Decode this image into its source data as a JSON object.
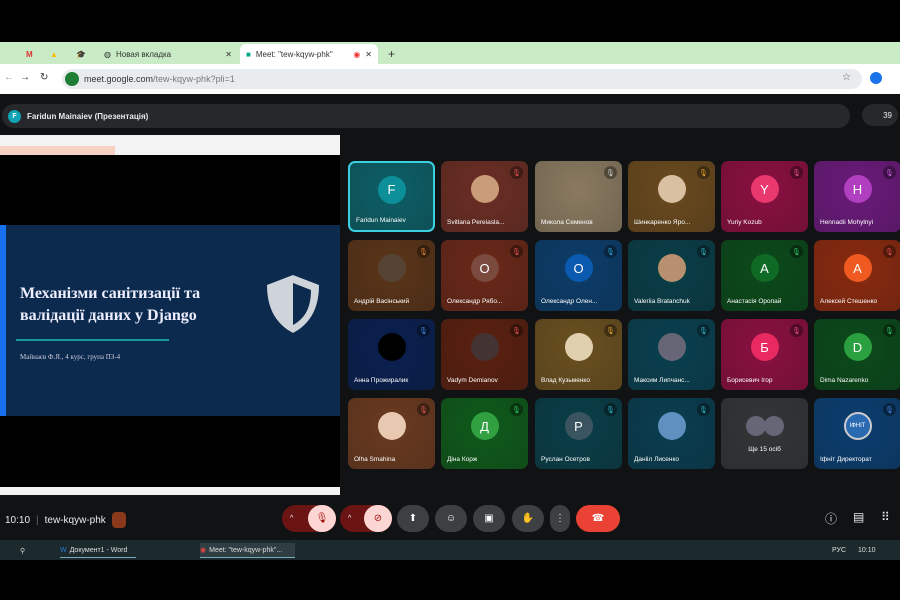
{
  "browser": {
    "tabs": [
      {
        "label": "",
        "icon": "gmail-icon"
      },
      {
        "label": "",
        "icon": "drive-icon"
      },
      {
        "label": "",
        "icon": "grad-cap-icon"
      },
      {
        "label": "Новая вкладка",
        "icon": "globe-icon"
      },
      {
        "label": "Meet: \"tew-kqyw-phk\"",
        "icon": "meet-icon",
        "active": true
      }
    ],
    "url_host": "meet.google.com",
    "url_path": "/tew-kqyw-phk?pli=1"
  },
  "meet": {
    "presenter_initial": "F",
    "presenter": "Faridun Mainaiev (Презентація)",
    "participant_count": "39",
    "time": "10:10",
    "meeting_code": "tew-kqyw-phk"
  },
  "slide": {
    "title": "Механізми санітизації та валідації даних у Django",
    "subtitle": "Майнаєв Ф.Я., 4 курс, група ПЗ-4"
  },
  "tiles": [
    {
      "name": "Faridun Mainaiev",
      "initial": "F",
      "bg": "#0d5f67",
      "av": "#0d8f9a",
      "mic": "",
      "active": true
    },
    {
      "name": "Svitlana Pereiaslа...",
      "initial": "",
      "bg": "#6b2e24",
      "av": "#c99c7a",
      "mic": "#e05050"
    },
    {
      "name": "Микола Семенов",
      "initial": "",
      "bg": "#8a7a60",
      "av": "",
      "mic": "#ccc"
    },
    {
      "name": "Шинкаренко Яро...",
      "initial": "",
      "bg": "#6a4a1e",
      "av": "#d8c0a0",
      "mic": "#e0a030"
    },
    {
      "name": "Yuriy Kozub",
      "initial": "Y",
      "bg": "#8a1040",
      "av": "#e8386e",
      "mic": "#e05080"
    },
    {
      "name": "Hennadii Mohylnyi",
      "initial": "H",
      "bg": "#6a1a7a",
      "av": "#b040c0",
      "mic": "#c060d0"
    },
    {
      "name": "Андрій Васінський",
      "initial": "",
      "bg": "#5a3418",
      "av": "#554433",
      "mic": "#e08030"
    },
    {
      "name": "Олександр Рябо...",
      "initial": "О",
      "bg": "#6a2818",
      "av": "#7a4a3e",
      "mic": "#e05050"
    },
    {
      "name": "Олександр Олен...",
      "initial": "О",
      "bg": "#0c3d6a",
      "av": "#0a5ab0",
      "mic": "#30a0d0"
    },
    {
      "name": "Valeriia Bratanchuk",
      "initial": "",
      "bg": "#0a3e48",
      "av": "#b89070",
      "mic": "#30b0c0"
    },
    {
      "name": "Анастасія Оропай",
      "initial": "А",
      "bg": "#0b4a1a",
      "av": "#0f6a25",
      "mic": "#30c060"
    },
    {
      "name": "Алексей Стешенко",
      "initial": "А",
      "bg": "#8a2a10",
      "av": "#f05a20",
      "mic": "#e05050"
    },
    {
      "name": "Анна Прожиралик",
      "initial": "",
      "bg": "#0a2050",
      "av": "#000",
      "mic": "#4080e0"
    },
    {
      "name": "Vadym Demianov",
      "initial": "",
      "bg": "#5a2010",
      "av": "#443333",
      "mic": "#e05050"
    },
    {
      "name": "Влад Кузьменко",
      "initial": "",
      "bg": "#6a5020",
      "av": "#e0d0b0",
      "mic": "#e0a030"
    },
    {
      "name": "Максим Липчанс...",
      "initial": "",
      "bg": "#0a4050",
      "av": "#667",
      "mic": "#30b0c0"
    },
    {
      "name": "Борисевич Ігор",
      "initial": "Б",
      "bg": "#8a1040",
      "av": "#e82a60",
      "mic": "#e05080"
    },
    {
      "name": "Dima Nazarenko",
      "initial": "D",
      "bg": "#0b4a1a",
      "av": "#2aa040",
      "mic": "#30c060"
    },
    {
      "name": "Olha Smahina",
      "initial": "",
      "bg": "#6a3a20",
      "av": "#e8c8b0",
      "mic": "#e05050"
    },
    {
      "name": "Діна Корж",
      "initial": "Д",
      "bg": "#0f5a1a",
      "av": "#30a040",
      "mic": "#30c060"
    },
    {
      "name": "Руслан Осетров",
      "initial": "Р",
      "bg": "#0a3e48",
      "av": "#3a5560",
      "mic": "#30b0c0"
    },
    {
      "name": "Данііл Лисенко",
      "initial": "",
      "bg": "#0a3e50",
      "av": "#6090c0",
      "mic": "#30b0c0"
    },
    {
      "name": "Ще 15 осіб",
      "initial": "",
      "bg": "#333537",
      "av": "",
      "mic": "",
      "more": true
    },
    {
      "name": "Іфніт Директорат",
      "initial": "ІФНІТ",
      "bg": "#0b3e70",
      "av": "#2a6ab0",
      "mic": "#4080e0"
    }
  ],
  "taskbar": {
    "word": "Документ1 - Word",
    "chrome": "Meet: \"tew-kqyw-phk\"...",
    "lang": "РУС",
    "time": "10:10"
  }
}
